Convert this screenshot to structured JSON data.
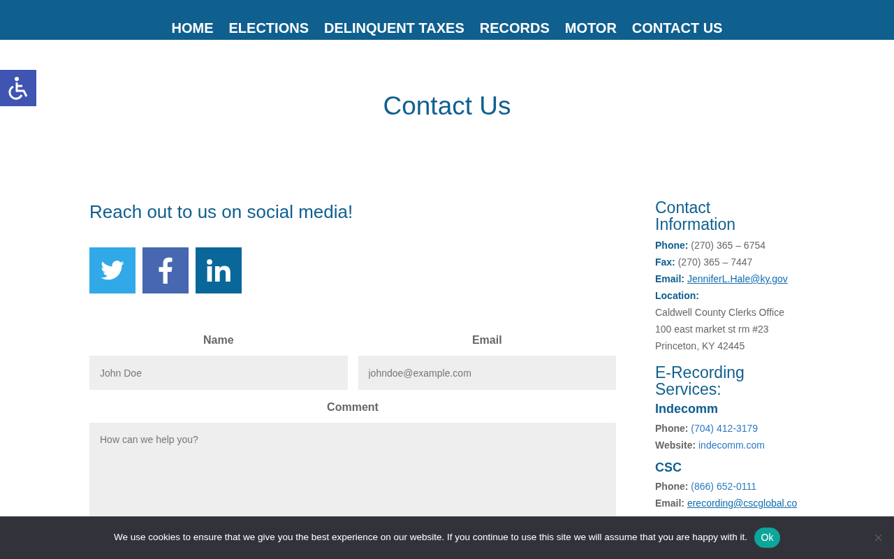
{
  "nav": [
    {
      "label": "HOME"
    },
    {
      "label": "ELECTIONS"
    },
    {
      "label": "DELINQUENT TAXES"
    },
    {
      "label": "RECORDS"
    },
    {
      "label": "MOTOR"
    },
    {
      "label": "CONTACT US"
    }
  ],
  "page_title": "Contact Us",
  "social": {
    "heading": "Reach out to us on social media!",
    "icons": [
      {
        "kind": "twitter",
        "color": "#31a9e8"
      },
      {
        "kind": "facebook",
        "color": "#4767b0"
      },
      {
        "kind": "linkedin",
        "color": "#0a6799"
      }
    ]
  },
  "form": {
    "fields": [
      {
        "label": "Name",
        "placeholder": "John Doe",
        "kind": "input"
      },
      {
        "label": "Email",
        "placeholder": "johndoe@example.com",
        "kind": "input"
      },
      {
        "label": "Comment",
        "placeholder": "How can we help you?",
        "kind": "textarea"
      }
    ]
  },
  "contact_info": {
    "title": "Contact Information",
    "lines": [
      {
        "kind": "text",
        "label": "Phone:",
        "value": "(270) 365 – 6754"
      },
      {
        "kind": "text",
        "label": "Fax:",
        "value": "(270) 365 – 7447"
      },
      {
        "kind": "email",
        "label": "Email:",
        "value": "JenniferL.Hale@ky.gov"
      },
      {
        "kind": "label",
        "label": "Location:"
      },
      {
        "kind": "plain",
        "value": "Caldwell County Clerks Office"
      },
      {
        "kind": "plain",
        "value": "100 east market st rm #23"
      },
      {
        "kind": "plain",
        "value": "Princeton, KY 42445"
      }
    ]
  },
  "e_recording": {
    "title": "E-Recording Services:",
    "providers": [
      {
        "name": "Indecomm",
        "lines": [
          {
            "kind": "link",
            "label": "Phone:",
            "value": "(704) 412-3179"
          },
          {
            "kind": "link",
            "label": "Website:",
            "value": "indecomm.com"
          }
        ]
      },
      {
        "name": "CSC",
        "lines": [
          {
            "kind": "link",
            "label": "Phone:",
            "value": "(866) 652-0111"
          },
          {
            "kind": "email",
            "label": "Email:",
            "value": "erecording@cscglobal.co"
          }
        ]
      }
    ]
  },
  "cookie_bar": {
    "message": "We use cookies to ensure that we give you the best experience on our website. If you continue to use this site we will assume that you are happy with it.",
    "button": "Ok",
    "close": "×"
  }
}
